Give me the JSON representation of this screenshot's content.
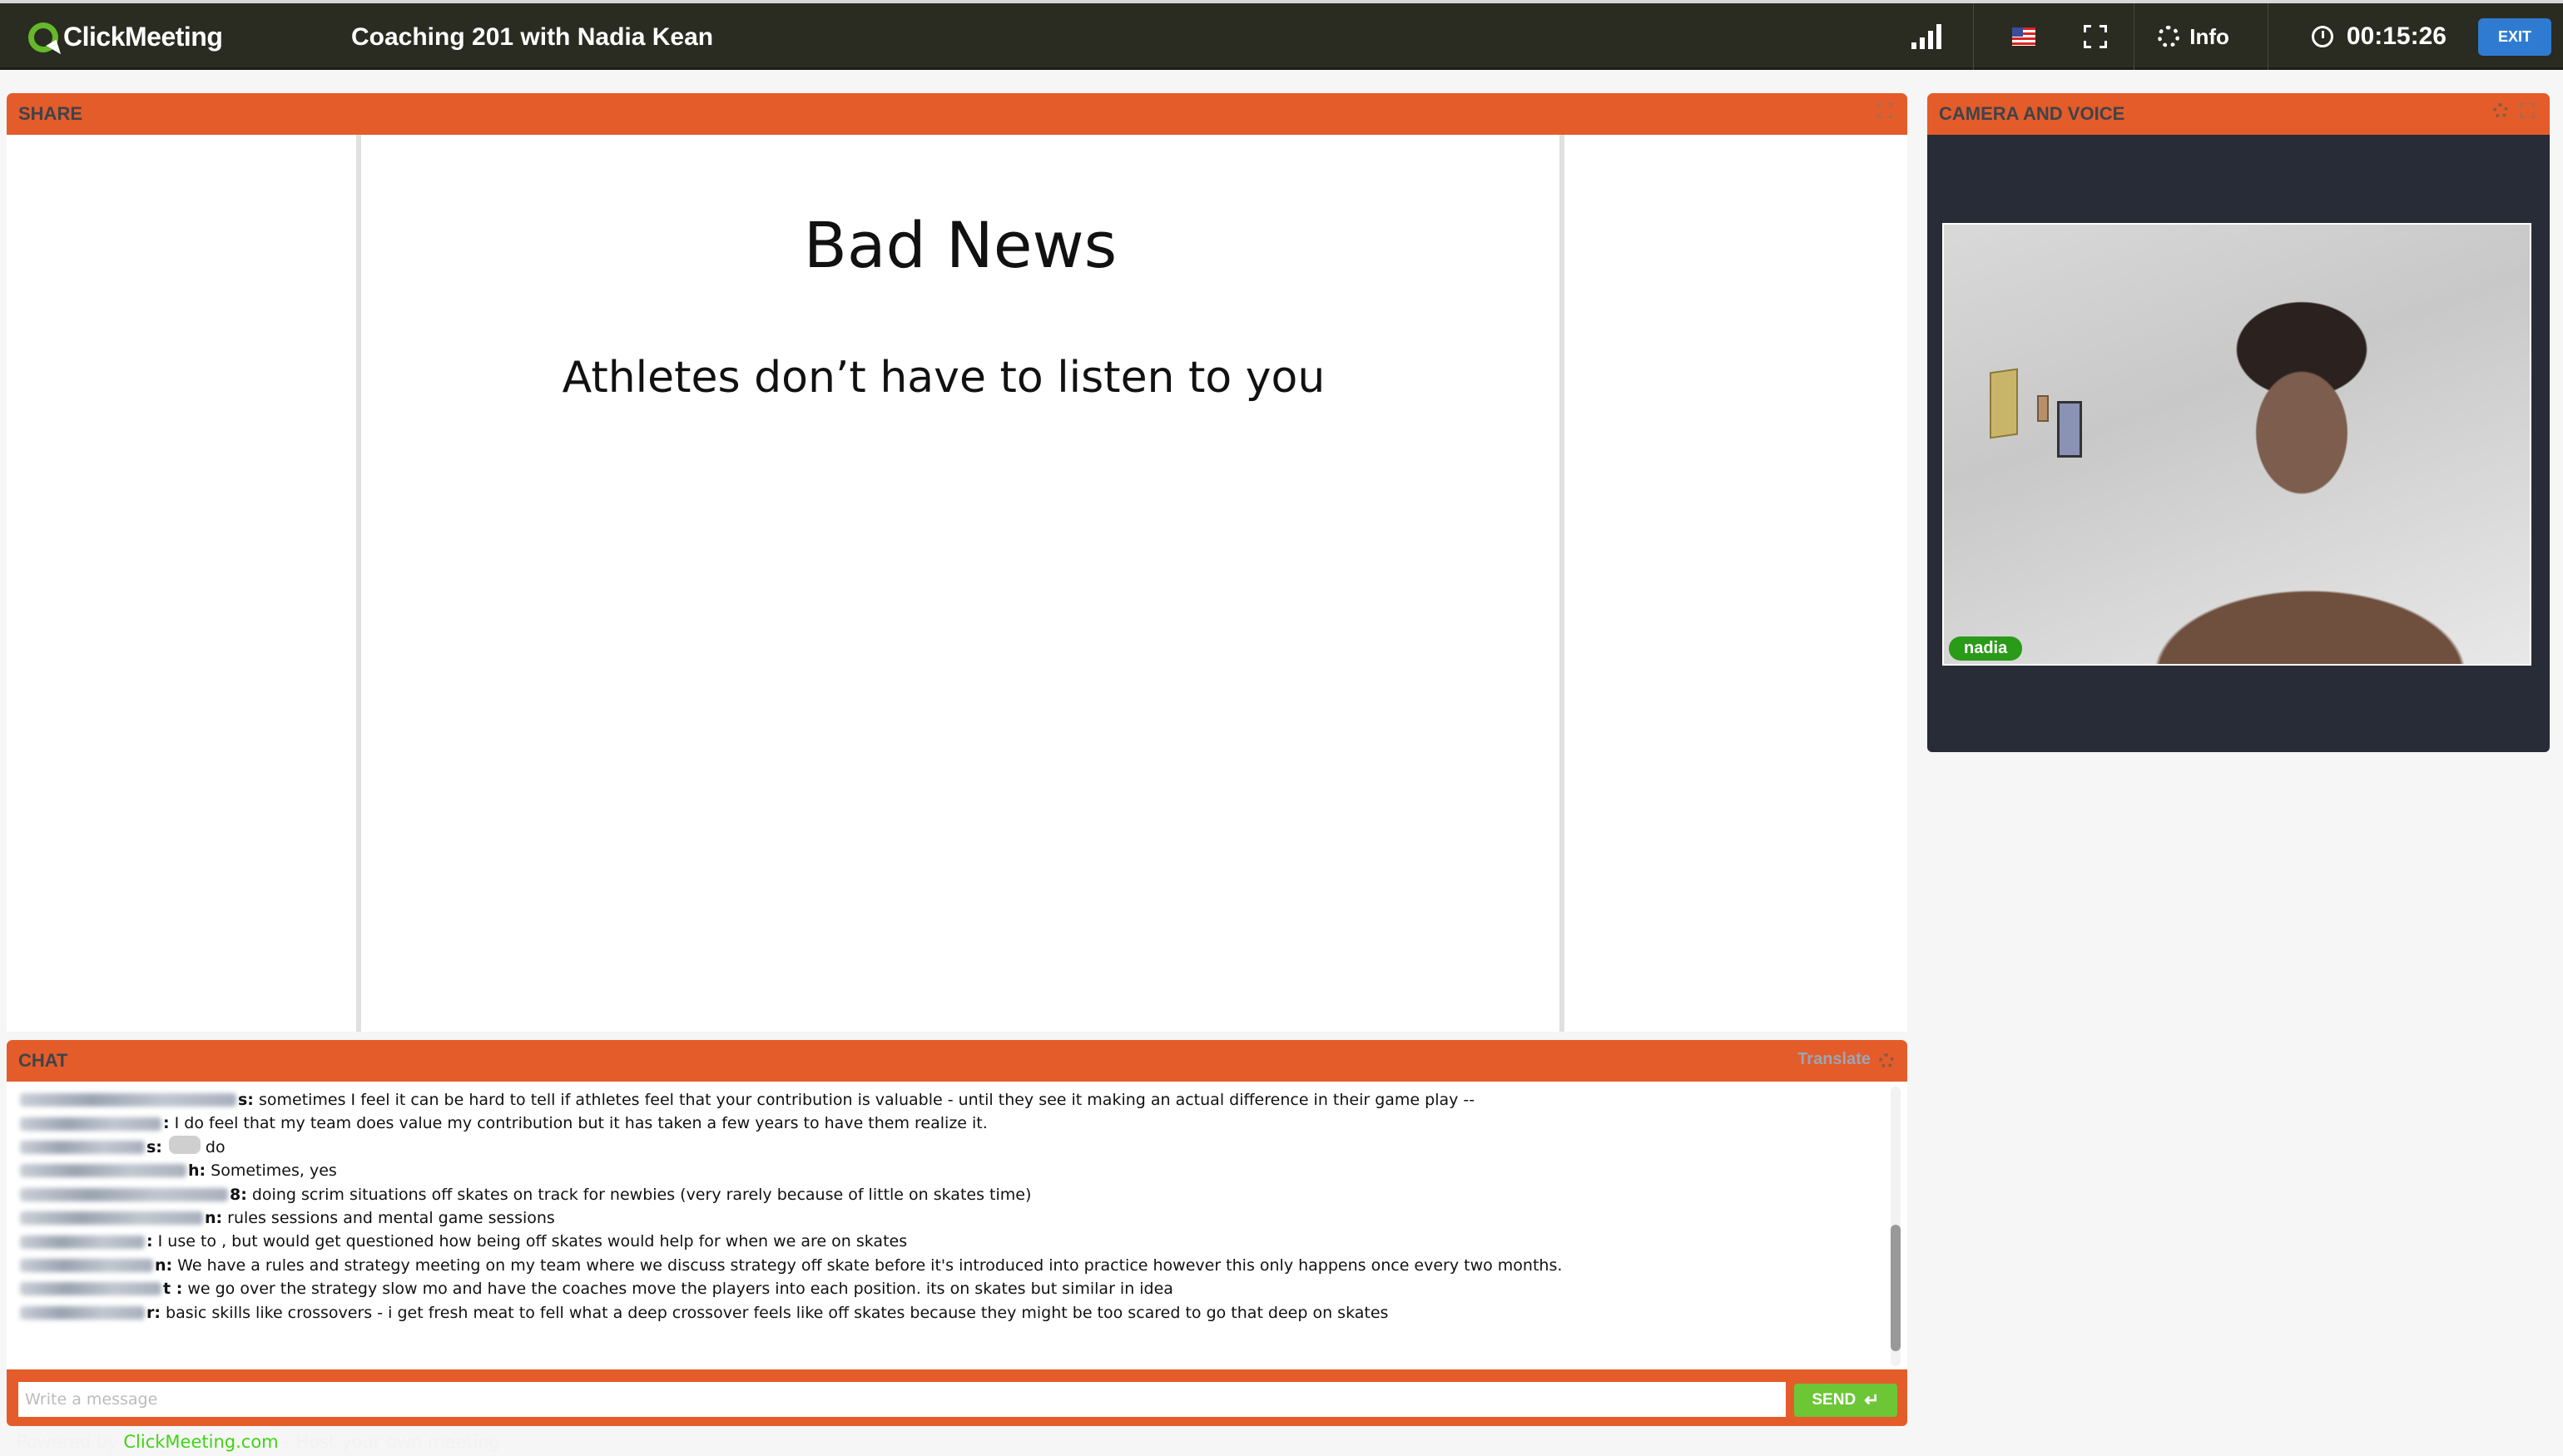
{
  "header": {
    "logo_text": "ClickMeeting",
    "meeting_title": "Coaching 201 with Nadia Kean",
    "info_label": "Info",
    "timer": "00:15:26",
    "exit_label": "EXIT",
    "icons": [
      "signal-strength-icon",
      "us-flag-icon",
      "fullscreen-icon",
      "gear-icon",
      "clock-icon"
    ]
  },
  "share": {
    "title": "SHARE",
    "slide": {
      "title": "Bad News",
      "subtitle": "Athletes don’t have to listen to you"
    }
  },
  "camera": {
    "title": "CAMERA AND VOICE",
    "participant_name": "nadia"
  },
  "chat": {
    "title": "CHAT",
    "translate_label": "Translate",
    "messages": [
      {
        "sender_suffix": "s:",
        "text": "sometimes I feel it can be hard to tell if athletes feel that your contribution is valuable - until they see it making an actual difference in their game play --"
      },
      {
        "sender_suffix": ":",
        "text": "I do feel that my team does value my contribution but it has taken a few years to have them realize it."
      },
      {
        "sender_suffix": "s:",
        "text": "do"
      },
      {
        "sender_suffix": "h:",
        "text": "Sometimes, yes"
      },
      {
        "sender_suffix": "8:",
        "text": "doing scrim situations off skates on track for newbies (very rarely because of little on skates time)"
      },
      {
        "sender_suffix": "n:",
        "text": "rules sessions and mental game sessions"
      },
      {
        "sender_suffix": ":",
        "text": "I use to , but would get questioned how being off skates would help for when we are on skates"
      },
      {
        "sender_suffix": "n:",
        "text": "We have a rules and strategy meeting on my team where we discuss strategy off skate before it's introduced into practice however this only happens once every two months."
      },
      {
        "sender_suffix": "t :",
        "text": "we go over the strategy slow mo and have the coaches move the players into each position. its on skates but similar in idea"
      },
      {
        "sender_suffix": "r:",
        "text": "basic skills like crossovers - i get fresh meat to fell what a deep crossover feels like off skates because they might be too scared to go that deep on skates"
      }
    ],
    "input_placeholder": "Write a message",
    "input_value": "",
    "send_label": "SEND"
  },
  "footer": {
    "prefix": "Powered by ",
    "link": "ClickMeeting.com",
    "suffix": " - Host your own meeting"
  },
  "colors": {
    "panel_header": "#e45c29",
    "topbar": "#2a2b21",
    "exit_button": "#2f7bd1",
    "send_button": "#6cc636",
    "name_tag": "#2a9a19"
  }
}
